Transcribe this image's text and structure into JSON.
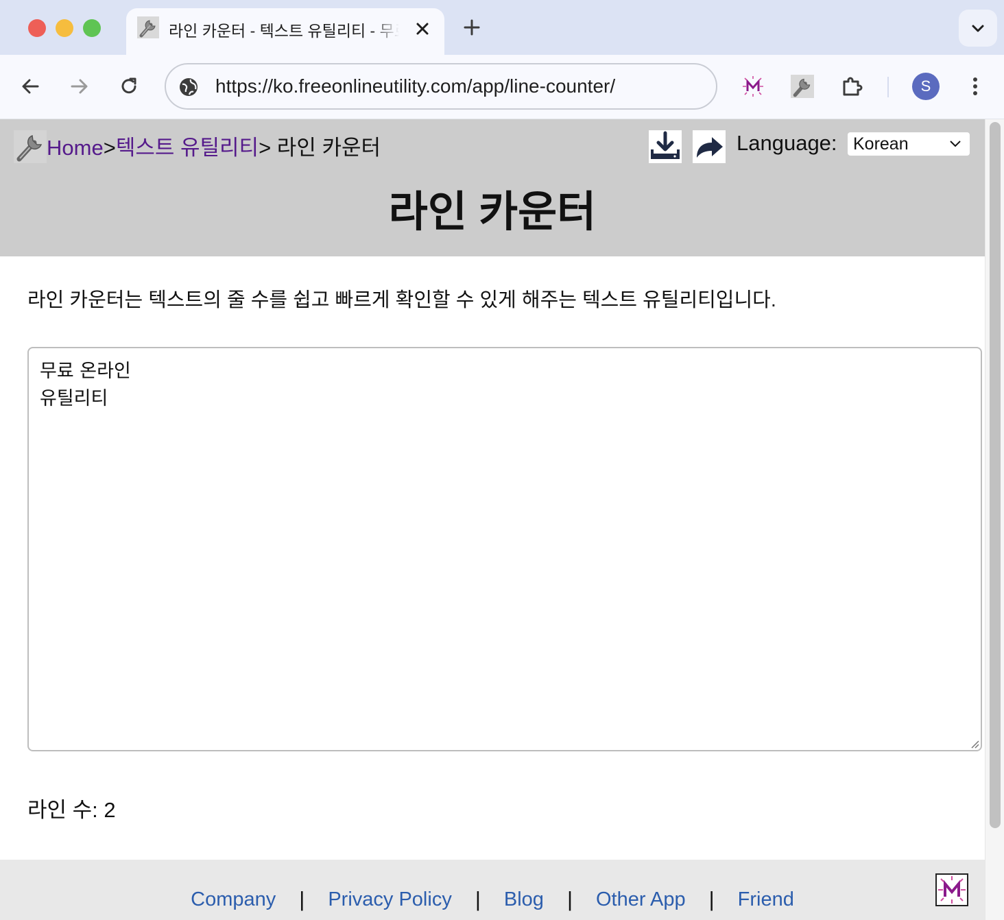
{
  "browser": {
    "tab_title": "라인 카운터 - 텍스트 유틸리티 - 무료 온라인 유틸리티",
    "url": "https://ko.freeonlineutility.com/app/line-counter/",
    "profile_initial": "S"
  },
  "header": {
    "breadcrumb": {
      "home": "Home",
      "sep1": ">",
      "category": "텍스트 유틸리티",
      "current": "> 라인 카운터"
    },
    "language_label": "Language:",
    "language_selected": "Korean",
    "title": "라인 카운터"
  },
  "main": {
    "description": "라인 카운터는 텍스트의 줄 수를 쉽고 빠르게 확인할 수 있게 해주는 텍스트 유틸리티입니다.",
    "input_text": "무료 온라인\n유틸리티",
    "line_count": "라인 수: 2"
  },
  "footer": {
    "links": [
      "Company",
      "Privacy Policy",
      "Blog",
      "Other App",
      "Friend"
    ],
    "separator": "|"
  },
  "colors": {
    "header_bg": "#cccccc",
    "visited_link": "#551a8b",
    "footer_link": "#2b5dad",
    "footer_bg": "#e8e8e8"
  }
}
